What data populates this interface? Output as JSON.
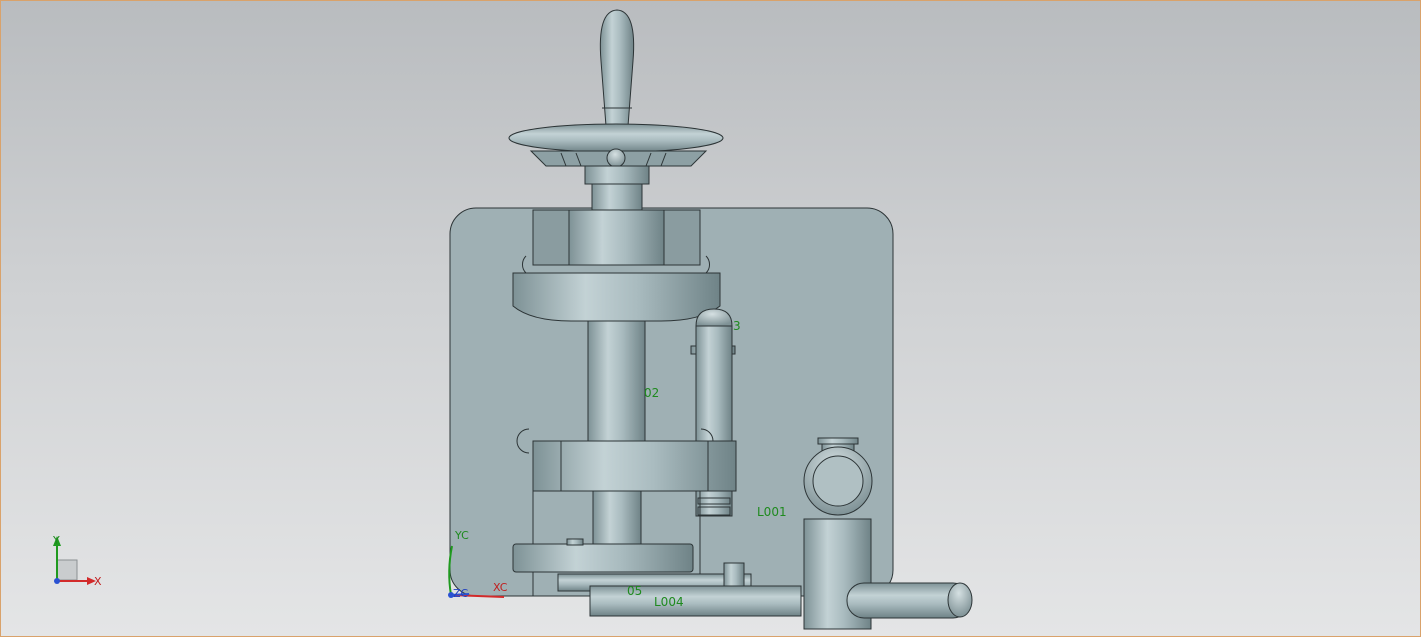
{
  "viewport": {
    "background_top": "#b9bcbf",
    "background_bottom": "#e4e5e6",
    "border_color": "#d9a26b",
    "model_color": "#9fb0b4",
    "label_color": "#1f8a1f"
  },
  "annotations": {
    "l001": "L001",
    "l004": "L004",
    "label_02": "02",
    "label_03": "3",
    "label_05": "05"
  },
  "wcs_triad": {
    "y_label": "YC",
    "x_label": "XC",
    "z_label": "ZC"
  },
  "view_triad": {
    "y_label": "Y",
    "x_label": "X"
  },
  "icons": [
    "handwheel",
    "wcs-triad-icon",
    "view-triad-icon"
  ]
}
